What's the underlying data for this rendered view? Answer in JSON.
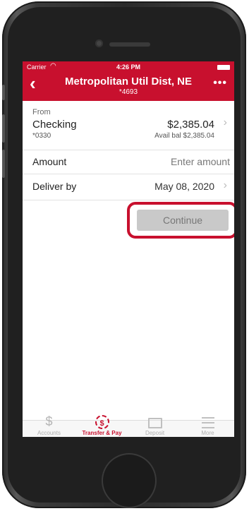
{
  "status_bar": {
    "carrier": "Carrier",
    "time": "4:26 PM"
  },
  "header": {
    "title": "Metropolitan Util Dist, NE",
    "subtitle": "*4693",
    "back_icon": "chevron-left-icon",
    "more_icon": "ellipsis-icon"
  },
  "from": {
    "label": "From",
    "account_name": "Checking",
    "account_number": "*0330",
    "balance": "$2,385.04",
    "available": "Avail bal $2,385.04"
  },
  "amount": {
    "label": "Amount",
    "placeholder": "Enter amount"
  },
  "deliver_by": {
    "label": "Deliver by",
    "value": "May 08, 2020"
  },
  "continue_button": {
    "label": "Continue"
  },
  "tabs": [
    {
      "label": "Accounts",
      "icon": "dollar-icon",
      "active": false
    },
    {
      "label": "Transfer & Pay",
      "icon": "transfer-pay-icon",
      "active": true
    },
    {
      "label": "Deposit",
      "icon": "deposit-icon",
      "active": false
    },
    {
      "label": "More",
      "icon": "menu-icon",
      "active": false
    }
  ],
  "colors": {
    "brand": "#c8102e",
    "disabled_button": "#c9c9c9",
    "highlight": "#c8102e"
  }
}
